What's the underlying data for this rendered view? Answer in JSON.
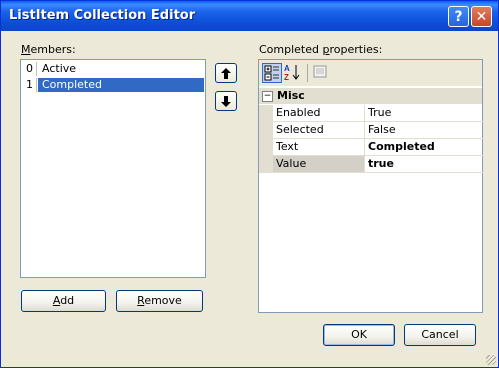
{
  "window": {
    "title": "ListItem Collection Editor",
    "help_glyph": "?",
    "close_glyph": "✕"
  },
  "members": {
    "label_prefix": "",
    "label_mnemonic": "M",
    "label_rest": "embers:",
    "items": [
      {
        "index": "0",
        "text": "Active"
      },
      {
        "index": "1",
        "text": "Completed"
      }
    ],
    "selected_index": 1,
    "up_glyph": "🡅",
    "down_glyph": "🡇"
  },
  "buttons": {
    "add_mnemonic": "A",
    "add_rest": "dd",
    "remove_mnemonic": "R",
    "remove_rest": "emove",
    "ok": "OK",
    "cancel": "Cancel"
  },
  "properties": {
    "label_pre": "Completed ",
    "label_mnemonic": "p",
    "label_rest": "roperties:",
    "category": "Misc",
    "category_toggle": "−",
    "rows": [
      {
        "name": "Enabled",
        "value": "True",
        "bold": false
      },
      {
        "name": "Selected",
        "value": "False",
        "bold": false
      },
      {
        "name": "Text",
        "value": "Completed",
        "bold": true
      },
      {
        "name": "Value",
        "value": "true",
        "bold": true
      }
    ],
    "toolbar": [
      "categorized-icon",
      "alphabetical-icon",
      "property-pages-icon"
    ]
  },
  "colors": {
    "selection": "#316ac5",
    "title_bar": "#0a5cf5",
    "dialog_bg": "#ece9d8"
  }
}
